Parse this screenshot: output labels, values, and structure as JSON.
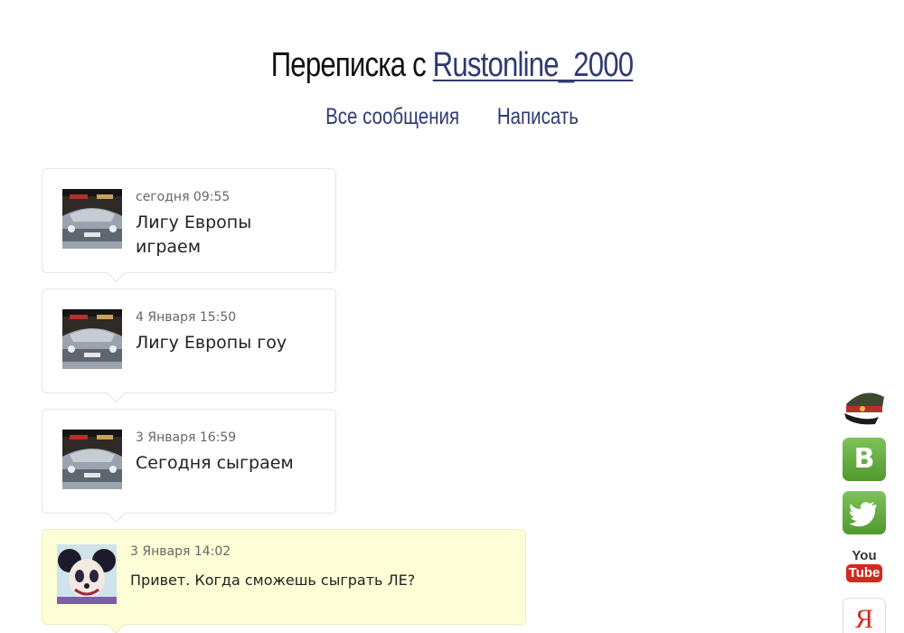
{
  "header": {
    "title_prefix": "Переписка с",
    "username": "Rustonline_2000"
  },
  "nav": {
    "all_messages": "Все сообщения",
    "write": "Написать"
  },
  "messages": [
    {
      "date": "сегодня 09:55",
      "text": "Лигу Европы играем"
    },
    {
      "date": "4 Января 15:50",
      "text": "Лигу Европы гоу"
    },
    {
      "date": "3 Января 16:59",
      "text": "Сегодня сыграем"
    },
    {
      "date": "3 Января 14:02",
      "text": "Привет. Когда сможешь сыграть ЛЕ?"
    }
  ],
  "social": {
    "vk": "B",
    "youtube_top": "You",
    "youtube_bottom": "Tube",
    "yandex": "Я"
  }
}
